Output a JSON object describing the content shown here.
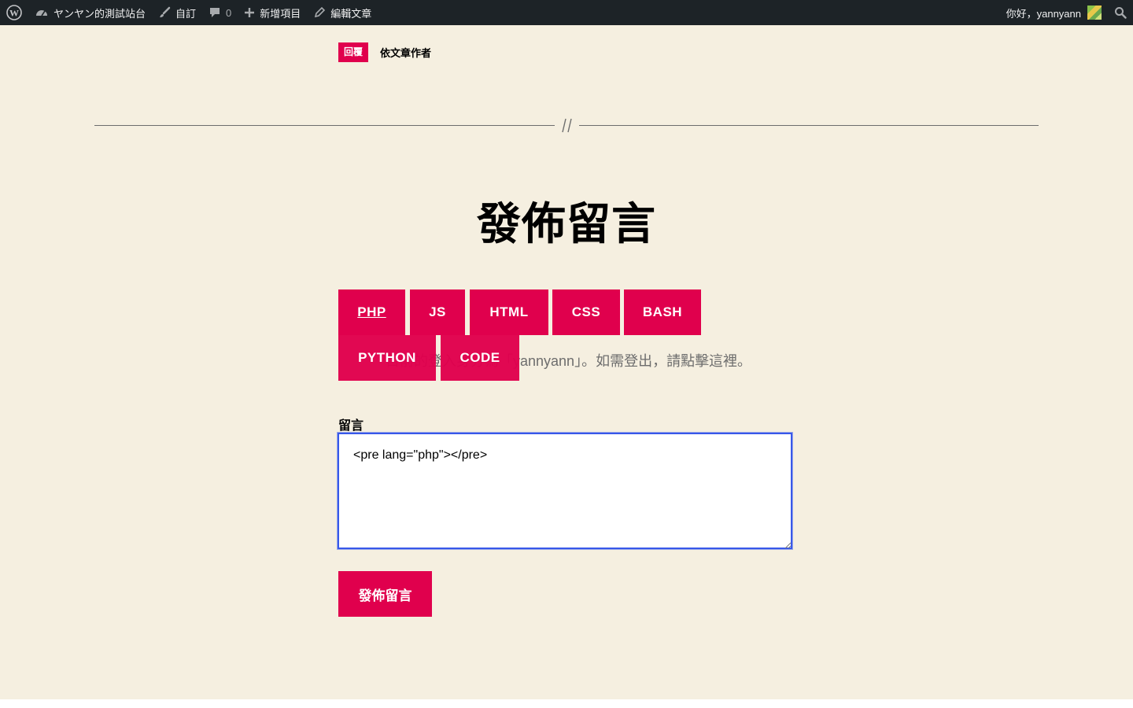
{
  "adminbar": {
    "site_name": "ヤンヤン的測試站台",
    "customize": "自訂",
    "comments_count": "0",
    "new_item": "新增項目",
    "edit_post": "編輯文章",
    "greeting": "你好，yannyann"
  },
  "reply": {
    "badge": "回覆",
    "author_label": "依文章作者"
  },
  "separator": "//",
  "form": {
    "heading": "發佈留言",
    "quicktags": [
      "PHP",
      "JS",
      "HTML",
      "CSS",
      "BASH",
      "PYTHON",
      "CODE"
    ],
    "logged_in_text": "目前的登入身分為「yannyann」。如需登出，請點擊這裡。",
    "comment_label": "留言",
    "comment_value": "<pre lang=\"php\"></pre>",
    "submit_label": "發佈留言"
  }
}
